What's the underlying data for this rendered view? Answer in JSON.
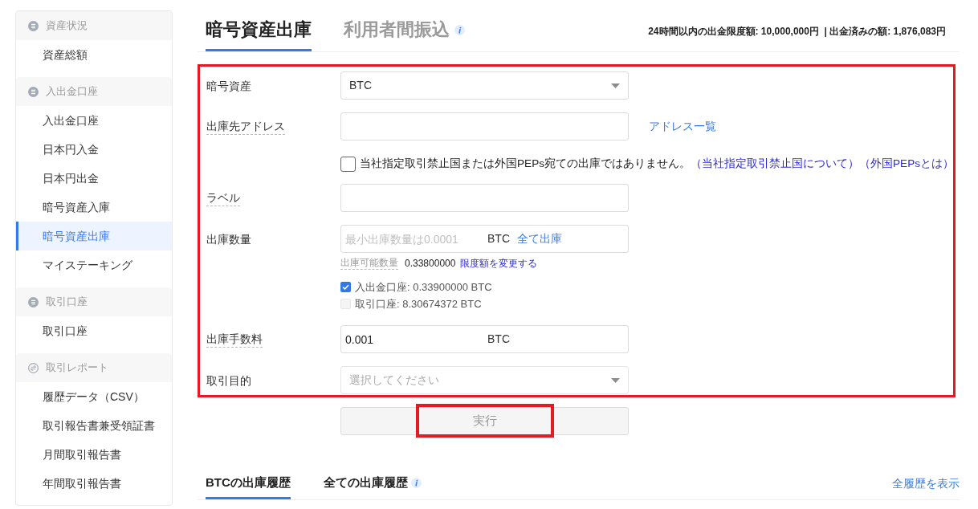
{
  "sidebar": {
    "sections": [
      {
        "title": "資産状況",
        "kind": "account",
        "items": [
          {
            "label": "資産総額",
            "selected": false
          }
        ]
      },
      {
        "title": "入出金口座",
        "kind": "account",
        "items": [
          {
            "label": "入出金口座",
            "selected": false
          },
          {
            "label": "日本円入金",
            "selected": false
          },
          {
            "label": "日本円出金",
            "selected": false
          },
          {
            "label": "暗号資産入庫",
            "selected": false
          },
          {
            "label": "暗号資産出庫",
            "selected": true
          },
          {
            "label": "マイステーキング",
            "selected": false
          }
        ]
      },
      {
        "title": "取引口座",
        "kind": "account",
        "items": [
          {
            "label": "取引口座",
            "selected": false
          }
        ]
      },
      {
        "title": "取引レポート",
        "kind": "report",
        "items": [
          {
            "label": "履歴データ（CSV）",
            "selected": false
          },
          {
            "label": "取引報告書兼受領証書",
            "selected": false
          },
          {
            "label": "月間取引報告書",
            "selected": false
          },
          {
            "label": "年間取引報告書",
            "selected": false
          }
        ]
      }
    ]
  },
  "tabs": [
    {
      "label": "暗号資産出庫",
      "selected": true,
      "info": false
    },
    {
      "label": "利用者間振込",
      "selected": false,
      "info": true
    }
  ],
  "limits": "24時間以内の出金限度額: 10,000,000円  | 出金済みの額: 1,876,083円",
  "form": {
    "highlighted": true,
    "rows": [
      {
        "kind": "select",
        "label": "暗号資産",
        "tooltip": false,
        "value": "BTC"
      },
      {
        "kind": "text",
        "label": "出庫先アドレス",
        "tooltip": true,
        "link": "アドレス一覧"
      },
      {
        "kind": "agreement",
        "checked": false,
        "text": "当社指定取引禁止国または外国PEPs宛ての出庫ではありません。",
        "links": [
          "（当社指定取引禁止国について）",
          "（外国PEPsとは）"
        ]
      },
      {
        "kind": "text",
        "label": "ラベル",
        "tooltip": true
      },
      {
        "kind": "unit_input",
        "label": "出庫数量",
        "tooltip": false,
        "placeholder": "最小出庫数量は0.0001",
        "unit": "BTC",
        "link": "全て出庫",
        "available": {
          "label": "出庫可能数量",
          "tooltip": true,
          "value": "0.33800000",
          "link": "限度額を変更する"
        },
        "sources": [
          {
            "text": "入出金口座: 0.33900000 BTC",
            "checked": true,
            "disabled": false
          },
          {
            "text": "取引口座: 8.30674372 BTC",
            "checked": false,
            "disabled": true
          }
        ]
      },
      {
        "kind": "unit_input",
        "label": "出庫手数料",
        "tooltip": true,
        "value": "0.001",
        "unit": "BTC"
      },
      {
        "kind": "select",
        "label": "取引目的",
        "tooltip": false,
        "placeholder": "選択してください"
      }
    ]
  },
  "submit": {
    "label": "実行",
    "disabled": true,
    "highlighted": true
  },
  "history": {
    "tabs": [
      {
        "label": "BTCの出庫履歴",
        "selected": true,
        "info": false
      },
      {
        "label": "全ての出庫履歴",
        "selected": false,
        "info": true
      }
    ],
    "link": "全履歴を表示"
  }
}
